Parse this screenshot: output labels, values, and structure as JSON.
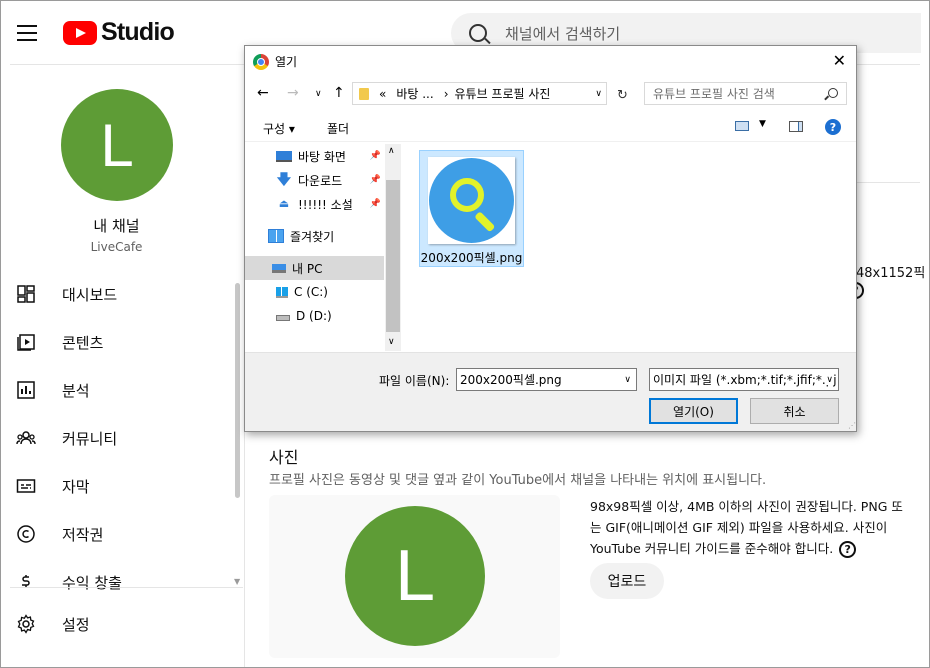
{
  "header": {
    "logo_text": "Studio",
    "search_placeholder": "채널에서 검색하기"
  },
  "sidebar": {
    "avatar_letter": "L",
    "channel_title": "내 채널",
    "channel_name": "LiveCafe",
    "items": [
      {
        "label": "대시보드",
        "icon": "dashboard-icon"
      },
      {
        "label": "콘텐츠",
        "icon": "content-icon"
      },
      {
        "label": "분석",
        "icon": "analytics-icon"
      },
      {
        "label": "커뮤니티",
        "icon": "community-icon"
      },
      {
        "label": "자막",
        "icon": "subtitles-icon"
      },
      {
        "label": "저작권",
        "icon": "copyright-icon"
      },
      {
        "label": "수익 창출",
        "icon": "monetization-icon"
      }
    ],
    "settings_label": "설정"
  },
  "main": {
    "right_fragment": "48x1152픽",
    "section_title": "사진",
    "section_desc": "프로필 사진은 동영상 및 댓글 옆과 같이 YouTube에서 채널을 나타내는 위치에 표시됩니다.",
    "avatar_letter": "L",
    "info_lines": [
      "98x98픽셀 이상, 4MB 이하의 사진이 권장됩니다. PNG 또",
      "는 GIF(애니메이션 GIF 제외) 파일을 사용하세요. 사진이",
      "YouTube 커뮤니티 가이드를 준수해야 합니다."
    ],
    "upload_label": "업로드"
  },
  "dialog": {
    "title": "열기",
    "address_prefix": "«",
    "address_segments": [
      "바탕 ...",
      "유튜브 프로필 사진"
    ],
    "search_placeholder": "유튜브 프로필 사진 검색",
    "toolbar": {
      "organize": "구성",
      "new_folder": "폴더"
    },
    "tree": [
      {
        "label": "바탕 화면",
        "icon": "desktop-icon",
        "pinned": true
      },
      {
        "label": "다운로드",
        "icon": "download-icon",
        "pinned": true
      },
      {
        "label": "!!!!!! 소설",
        "icon": "eject-icon",
        "pinned": true
      },
      {
        "label": "즐겨찾기",
        "icon": "favorites-icon",
        "pinned": false
      },
      {
        "label": "내 PC",
        "icon": "pc-icon",
        "pinned": false,
        "selected": true
      },
      {
        "label": "C (C:)",
        "icon": "windows-drive-icon",
        "pinned": false
      },
      {
        "label": "D (D:)",
        "icon": "drive-icon",
        "pinned": false
      }
    ],
    "file": {
      "name": "200x200픽셀.png"
    },
    "filename_label": "파일 이름(N):",
    "filename_value": "200x200픽셀.png",
    "filetype_value": "이미지 파일 (*.xbm;*.tif;*.jfif;*.pj",
    "open_label": "열기(O)",
    "cancel_label": "취소"
  },
  "colors": {
    "avatar_green": "#5e9c36",
    "youtube_red": "#ff0000",
    "selection_blue": "#cce8ff",
    "accent_blue": "#0078d7"
  }
}
